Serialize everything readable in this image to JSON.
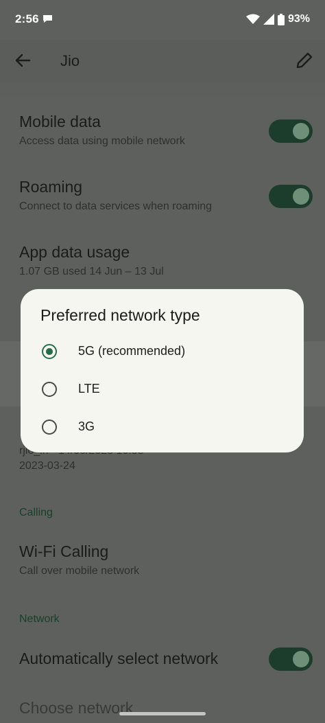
{
  "status_bar": {
    "time": "2:56",
    "battery": "93%"
  },
  "app_bar": {
    "title": "Jio"
  },
  "settings": {
    "mobile_data": {
      "title": "Mobile data",
      "subtitle": "Access data using mobile network",
      "enabled": true
    },
    "roaming": {
      "title": "Roaming",
      "subtitle": "Connect to data services when roaming",
      "enabled": true
    },
    "app_data_usage": {
      "title": "App data usage",
      "subtitle": "1.07 GB used 14 Jun – 13 Jul"
    },
    "partially_hidden_row": {
      "line1": "rjio_in · 14/06/2023 10:33",
      "line2": "2023-03-24"
    }
  },
  "sections": {
    "calling": "Calling",
    "network": "Network"
  },
  "calling": {
    "wifi_calling": {
      "title": "Wi-Fi Calling",
      "subtitle": "Call over mobile network"
    }
  },
  "network": {
    "auto_select": {
      "title": "Automatically select network",
      "enabled": true
    },
    "choose_network": {
      "title": "Choose network"
    }
  },
  "dialog": {
    "title": "Preferred network type",
    "options": [
      {
        "label": "5G (recommended)",
        "selected": true
      },
      {
        "label": "LTE",
        "selected": false
      },
      {
        "label": "3G",
        "selected": false
      }
    ]
  }
}
